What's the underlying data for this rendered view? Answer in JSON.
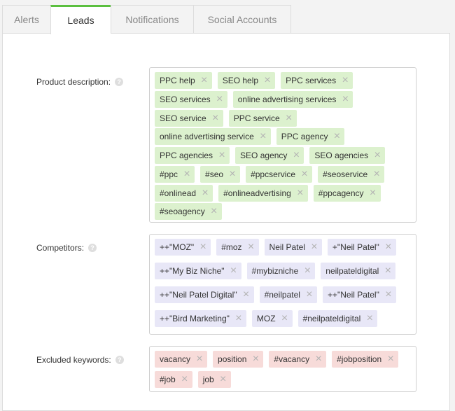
{
  "tabs": [
    {
      "label": "Alerts",
      "active": false
    },
    {
      "label": "Leads",
      "active": true
    },
    {
      "label": "Notifications",
      "active": false
    },
    {
      "label": "Social Accounts",
      "active": false
    }
  ],
  "colors": {
    "active_tab_accent": "#5bbf3f",
    "product_tag_bg": "#dcf1ce",
    "competitor_tag_bg": "#e8e7f7",
    "excluded_tag_bg": "#f7dbd9"
  },
  "fields": {
    "product": {
      "label": "Product description:",
      "help_icon": "question-circle-icon",
      "tags": [
        "PPC help",
        "SEO help",
        "PPC services",
        "SEO services",
        "online advertising services",
        "SEO service",
        "PPC service",
        "online advertising service",
        "PPC agency",
        "PPC agencies",
        "SEO agency",
        "SEO agencies",
        "#ppc",
        "#seo",
        "#ppcservice",
        "#seoservice",
        "#onlinead",
        "#onlineadvertising",
        "#ppcagency",
        "#seoagency"
      ]
    },
    "competitors": {
      "label": "Competitors:",
      "help_icon": "question-circle-icon",
      "tags": [
        "++\"MOZ\"",
        "#moz",
        "Neil Patel",
        "+\"Neil Patel\"",
        "++\"My Biz Niche\"",
        "#mybizniche",
        "neilpateldigital",
        "++\"Neil Patel Digital\"",
        "#neilpatel",
        "++\"Neil Patel\"",
        "++\"Bird Marketing\"",
        "MOZ",
        "#neilpateldigital"
      ]
    },
    "excluded": {
      "label": "Excluded keywords:",
      "help_icon": "question-circle-icon",
      "tags": [
        "vacancy",
        "position",
        "#vacancy",
        "#jobposition",
        "#job",
        "job"
      ]
    }
  },
  "remove_icon": "×"
}
